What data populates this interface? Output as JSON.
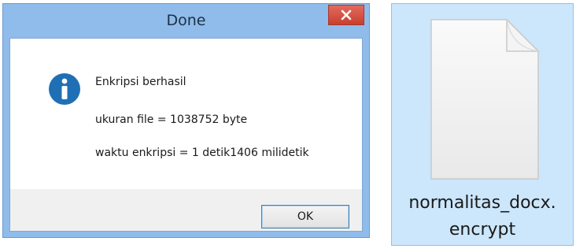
{
  "dialog": {
    "title": "Done",
    "message_lines": [
      "Enkripsi berhasil",
      "ukuran file = 1038752 byte",
      "waktu enkripsi = 1 detik1406 milidetik"
    ],
    "ok_label": "OK",
    "icons": {
      "close": "close-icon",
      "info": "info-icon"
    }
  },
  "file": {
    "name_line1": "normalitas_docx.",
    "name_line2": "encrypt",
    "icon": "document-icon"
  },
  "colors": {
    "titlebar": "#8fbcea",
    "close_button": "#c7402f",
    "info_icon": "#1f6fb5",
    "file_selection": "#cce6fb"
  }
}
